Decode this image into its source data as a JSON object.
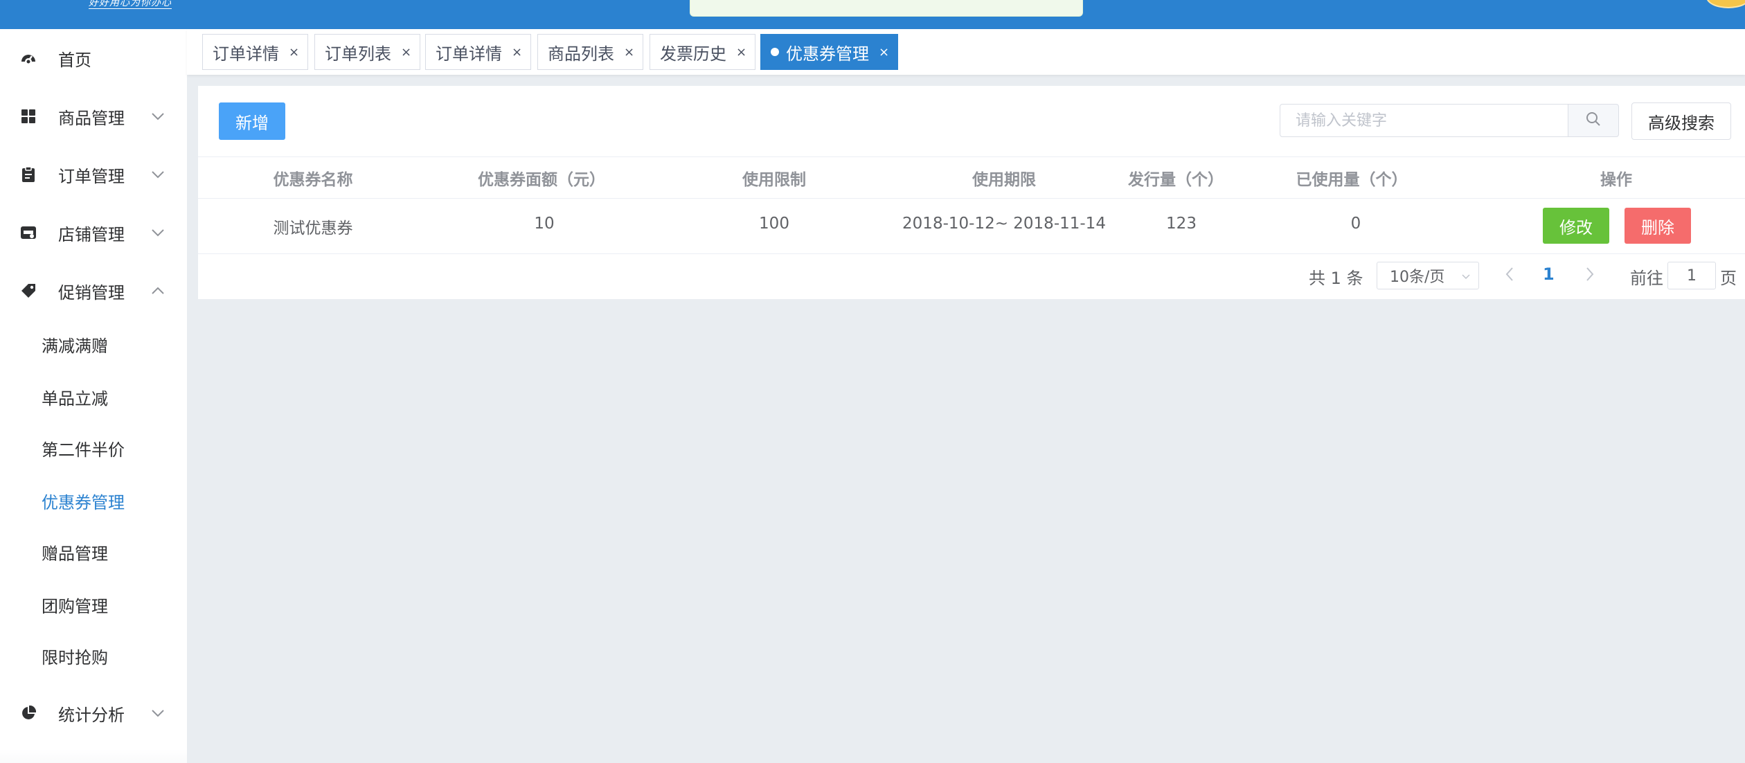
{
  "header": {
    "logo_text": "好好用心为你办心",
    "accent_color": "#2b82d0"
  },
  "sidebar": {
    "items": [
      {
        "label": "首页",
        "icon": "dashboard-icon"
      },
      {
        "label": "商品管理",
        "icon": "grid-icon"
      },
      {
        "label": "订单管理",
        "icon": "clipboard-icon"
      },
      {
        "label": "店铺管理",
        "icon": "store-icon"
      },
      {
        "label": "促销管理",
        "icon": "tag-icon",
        "expanded": true
      },
      {
        "label": "统计分析",
        "icon": "pie-chart-icon"
      }
    ],
    "promo_sub_items": [
      {
        "label": "满减满赠"
      },
      {
        "label": "单品立减"
      },
      {
        "label": "第二件半价"
      },
      {
        "label": "优惠券管理",
        "active": true
      },
      {
        "label": "赠品管理"
      },
      {
        "label": "团购管理"
      },
      {
        "label": "限时抢购"
      }
    ]
  },
  "tabs": [
    {
      "label": "订单详情",
      "close": "×"
    },
    {
      "label": "订单列表",
      "close": "×"
    },
    {
      "label": "订单详情",
      "close": "×"
    },
    {
      "label": "商品列表",
      "close": "×"
    },
    {
      "label": "发票历史",
      "close": "×"
    },
    {
      "label": "优惠券管理",
      "close": "×",
      "active": true
    }
  ],
  "toolbar": {
    "add_label": "新增",
    "search_placeholder": "请输入关键字",
    "advanced_search_label": "高级搜索"
  },
  "table": {
    "columns": [
      "优惠券名称",
      "优惠券面额（元）",
      "使用限制",
      "使用期限",
      "发行量（个）",
      "已使用量（个）",
      "操作"
    ],
    "rows": [
      {
        "name": "测试优惠券",
        "amount": "10",
        "limit": "100",
        "period": "2018-10-12~ 2018-11-14",
        "issued": "123",
        "used": "0",
        "edit_label": "修改",
        "delete_label": "删除"
      }
    ]
  },
  "pagination": {
    "total_text": "共 1 条",
    "page_size": "10条/页",
    "current_page": "1",
    "goto_label": "前往",
    "goto_value": "1",
    "page_unit": "页"
  },
  "colors": {
    "primary": "#2b82d0",
    "add_button": "#4aa3f8",
    "edit_button": "#67c23a",
    "delete_button": "#f56c6c",
    "background": "#e9edf1"
  }
}
